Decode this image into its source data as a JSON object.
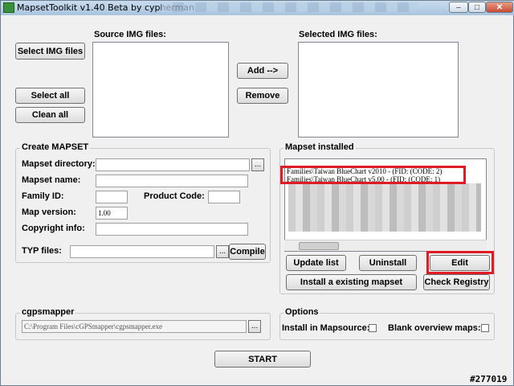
{
  "window": {
    "title": "MapsetToolkit v1.40 Beta by cypherman",
    "minimize": "–",
    "maximize": "□",
    "close": "✕"
  },
  "source": {
    "label": "Source IMG files:",
    "select_button": "Select IMG files",
    "select_all": "Select all",
    "clean_all": "Clean all"
  },
  "transfer": {
    "add": "Add -->",
    "remove": "Remove"
  },
  "selected": {
    "label": "Selected IMG files:"
  },
  "create": {
    "title": "Create MAPSET",
    "mapset_directory": "Mapset directory:",
    "mapset_name": "Mapset name:",
    "family_id": "Family ID:",
    "product_code": "Product Code:",
    "map_version": "Map version:",
    "map_version_value": "1.00",
    "copyright_info": "Copyright info:",
    "typ_files": "TYP files:",
    "browse": "...",
    "compile": "Compile"
  },
  "installed": {
    "title": "Mapset installed",
    "items": [
      "Families\\Taiwan BlueChart v2010 - (FID:       (CODE: 2)",
      "Families\\Taiwan BlueChart v5.00 - (FID:       (CODE: 1)"
    ],
    "update_list": "Update list",
    "uninstall": "Uninstall",
    "edit": "Edit",
    "install_existing": "Install a existing mapset",
    "check_registry": "Check Registry"
  },
  "cgps": {
    "title": "cgpsmapper",
    "path": "C:\\Program Files\\cGPSmapper\\cgpsmapper.exe",
    "browse": "..."
  },
  "options": {
    "title": "Options",
    "install_in_mapsource": "Install in Mapsource:",
    "blank_overview": "Blank overview maps:"
  },
  "start": "START",
  "watermark": "#277019",
  "colors": {
    "highlight_red": "#e01b24",
    "titlebar": "#b9d1e8"
  }
}
